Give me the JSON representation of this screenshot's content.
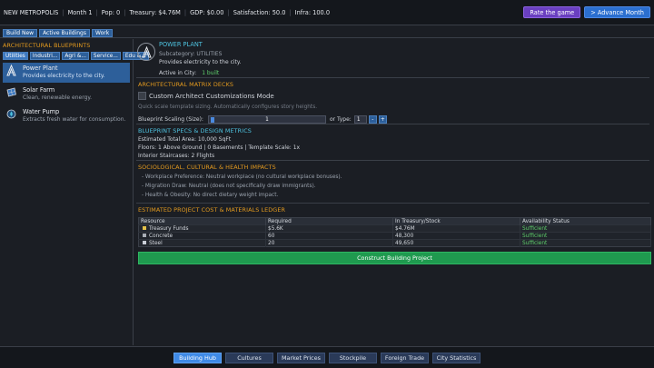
{
  "topbar": {
    "city": "NEW METROPOLIS",
    "month": "Month 1",
    "pop": "Pop: 0",
    "treasury": "Treasury: $4.76M",
    "gdp": "GDP: $0.00",
    "satisfaction": "Satisfaction: 50.0",
    "infra": "Infra: 100.0",
    "rate_label": "Rate the game",
    "advance_label": "> Advance Month"
  },
  "mode_tabs": [
    "Build New",
    "Active Buildings",
    "Work"
  ],
  "left": {
    "title": "ARCHITECTURAL BLUEPRINTS",
    "categories": [
      "Utilities",
      "Industri...",
      "Agri &...",
      "Service...",
      "Edu &..."
    ],
    "items": [
      {
        "name": "Power Plant",
        "desc": "Provides electricity to the city.",
        "icon": "power-plant-icon"
      },
      {
        "name": "Solar Farm",
        "desc": "Clean, renewable energy.",
        "icon": "solar-panel-icon"
      },
      {
        "name": "Water Pump",
        "desc": "Extracts fresh water for consumption.",
        "icon": "water-pump-icon"
      }
    ]
  },
  "detail": {
    "name": "POWER PLANT",
    "subcategory": "Subcategory: UTILITIES",
    "description": "Provides electricity to the city.",
    "active_label": "Active in City:",
    "active_value": "1 built"
  },
  "deck": {
    "title": "ARCHITECTURAL MATRIX DECKS",
    "custom_label": "Custom Architect Customizations Mode",
    "hint": "Quick scale template sizing. Automatically configures story heights.",
    "scale_label": "Blueprint Scaling (Size):",
    "scale_value": "1",
    "or_type": "or Type:",
    "type_value": "1",
    "minus": "-",
    "plus": "+"
  },
  "specs": {
    "title": "BLUEPRINT SPECS & DESIGN METRICS",
    "lines": [
      "Estimated Total Area: 10,000 SqFt",
      "Floors: 1 Above Ground | 0 Basements | Template Scale: 1x",
      "Interior Staircases: 2 Flights"
    ]
  },
  "impacts": {
    "title": "SOCIOLOGICAL, CULTURAL & HEALTH IMPACTS",
    "lines": [
      "- Workplace Preference: Neutral workplace (no cultural workplace bonuses).",
      "- Migration Draw: Neutral (does not specifically draw immigrants).",
      "- Health & Obesity: No direct dietary weight impact."
    ]
  },
  "ledger": {
    "title": "ESTIMATED PROJECT COST & MATERIALS LEDGER",
    "headers": [
      "Resource",
      "Required",
      "In Treasury/Stock",
      "Availability Status"
    ],
    "rows": [
      [
        "Treasury Funds",
        "$5.6K",
        "$4.76M",
        "Sufficient"
      ],
      [
        "Concrete",
        "60",
        "48,300",
        "Sufficient"
      ],
      [
        "Steel",
        "20",
        "49,650",
        "Sufficient"
      ]
    ],
    "row_colors": [
      "#e3c14a",
      "#a8adb5",
      "#c9ced6"
    ],
    "construct_label": "Construct Building Project"
  },
  "bottom_nav": [
    "Building Hub",
    "Cultures",
    "Market Prices",
    "Stockpile",
    "Foreign Trade",
    "City Statistics"
  ],
  "colors": {
    "accent_orange": "#e39a1e",
    "accent_cyan": "#4ec3e0",
    "success_green": "#5fcf6b",
    "primary_blue": "#2d5f9a",
    "construct_green": "#1f9a4f"
  }
}
